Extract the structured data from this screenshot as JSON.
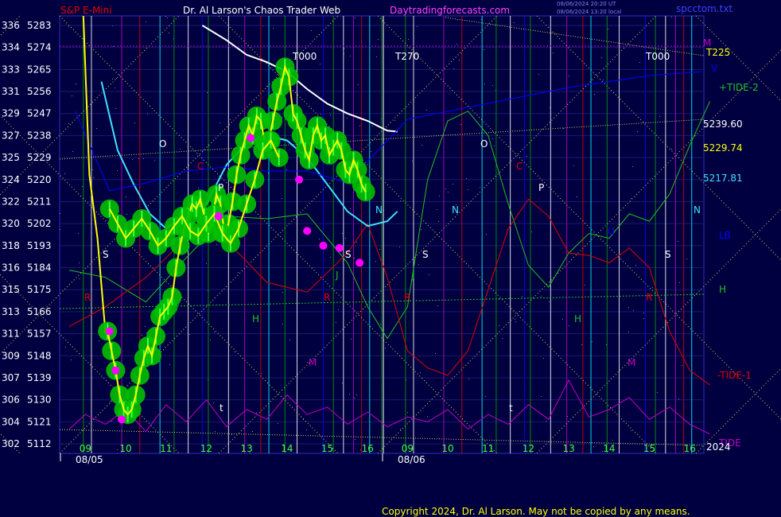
{
  "header": {
    "symbol": "S&P E-Mini",
    "title": "Dr. Al Larson's Chaos Trader Web",
    "site": "Daytradingforecasts.com",
    "time_line1": "08/06/2024 20:20 UT",
    "time_line2": "08/06/2024 13:20 local",
    "file": "spcctom.txt"
  },
  "footer": {
    "copyright": "Copyright 2024, Dr. Al Larson. May not be copied by any means."
  },
  "colors": {
    "background": "#000040",
    "price_bars": "#00c000",
    "price_line": "#ffff00",
    "cyan_avg": "#40e0ff",
    "white_avg": "#ffffff",
    "tide": "#c000c0",
    "tide1": "#e00000",
    "tide2": "#20c020",
    "blue_line": "#0000ff"
  },
  "chart_data": {
    "type": "line",
    "title": "S&P E-Mini",
    "y_axis": {
      "labels": [
        {
          "deg": "336",
          "price": "5283"
        },
        {
          "deg": "334",
          "price": "5274"
        },
        {
          "deg": "333",
          "price": "5265"
        },
        {
          "deg": "331",
          "price": "5256"
        },
        {
          "deg": "329",
          "price": "5247"
        },
        {
          "deg": "327",
          "price": "5238"
        },
        {
          "deg": "325",
          "price": "5229"
        },
        {
          "deg": "324",
          "price": "5220"
        },
        {
          "deg": "322",
          "price": "5211"
        },
        {
          "deg": "320",
          "price": "5202"
        },
        {
          "deg": "318",
          "price": "5193"
        },
        {
          "deg": "316",
          "price": "5184"
        },
        {
          "deg": "315",
          "price": "5175"
        },
        {
          "deg": "313",
          "price": "5166"
        },
        {
          "deg": "311",
          "price": "5157"
        },
        {
          "deg": "309",
          "price": "5148"
        },
        {
          "deg": "307",
          "price": "5139"
        },
        {
          "deg": "306",
          "price": "5130"
        },
        {
          "deg": "304",
          "price": "5121"
        },
        {
          "deg": "302",
          "price": "5112"
        }
      ],
      "ylim": [
        5112,
        5283
      ]
    },
    "x_axis": {
      "hour_ticks": [
        "09",
        "10",
        "11",
        "12",
        "13",
        "14",
        "15",
        "16",
        "09",
        "10",
        "11",
        "12",
        "13",
        "14",
        "15",
        "16"
      ],
      "dates": [
        "08/05",
        "08/06"
      ],
      "xlim": [
        8.5,
        16.5
      ]
    },
    "right_labels": [
      {
        "text": "M",
        "color": "#c000c0"
      },
      {
        "text": "T225",
        "color": "#ffff00"
      },
      {
        "text": "V",
        "color": "#0000ff"
      },
      {
        "text": "+TIDE-2",
        "color": "#20c020"
      },
      {
        "text": "5239.60",
        "color": "#ffffff"
      },
      {
        "text": "5229.74",
        "color": "#ffff00"
      },
      {
        "text": "5217.81",
        "color": "#40e0ff"
      },
      {
        "text": "M",
        "color": "#0000ff"
      },
      {
        "text": "N",
        "color": "#40e0ff"
      },
      {
        "text": "LB",
        "color": "#0000ff"
      },
      {
        "text": "H",
        "color": "#20c020"
      },
      {
        "text": "-TIDE-1",
        "color": "#e00000"
      },
      {
        "text": "TIDE",
        "color": "#c000c0"
      },
      {
        "text": "2024",
        "color": "#ffffff"
      }
    ],
    "markers": {
      "T000": "T000",
      "T270": "T270",
      "O": "O",
      "C": "C",
      "P": "P",
      "N": "N",
      "S": "S",
      "J": "J",
      "R": "R",
      "H": "H",
      "M": "M",
      "t": "t",
      "U": "U"
    },
    "series": [
      {
        "name": "S&P E-Mini",
        "color": "#ffff00",
        "day1_x": [
          9.55,
          9.65,
          9.75,
          9.85,
          9.95,
          10.05,
          10.15,
          10.25,
          10.35,
          10.45,
          10.55,
          10.65,
          10.75,
          10.85,
          10.95,
          11.05,
          11.15,
          11.25,
          11.35,
          11.45,
          11.55,
          11.65,
          11.75,
          11.85,
          11.95,
          12.05,
          12.15,
          12.25,
          12.35,
          12.45,
          12.55,
          12.65,
          12.75,
          12.85,
          12.95,
          13.05,
          13.15,
          13.25,
          13.35,
          13.45,
          13.55,
          13.65,
          13.75,
          13.85,
          13.95,
          14.05,
          14.15,
          14.25,
          14.35,
          14.45,
          14.55,
          14.65,
          14.75,
          14.85,
          14.95,
          15.05,
          15.15,
          15.25,
          15.35,
          15.45,
          15.55,
          15.65,
          15.75,
          15.85,
          15.95
        ],
        "day1_y": [
          5158,
          5150,
          5142,
          5132,
          5126,
          5124,
          5126,
          5132,
          5140,
          5147,
          5152,
          5148,
          5156,
          5164,
          5166,
          5168,
          5172,
          5184,
          5193,
          5200,
          5205,
          5210,
          5208,
          5212,
          5205,
          5198,
          5204,
          5214,
          5210,
          5198,
          5202,
          5211,
          5222,
          5230,
          5236,
          5242,
          5238,
          5246,
          5244,
          5235,
          5236,
          5244,
          5252,
          5258,
          5266,
          5262,
          5247,
          5244,
          5238,
          5232,
          5228,
          5238,
          5242,
          5236,
          5238,
          5230,
          5233,
          5236,
          5232,
          5224,
          5222,
          5228,
          5224,
          5218,
          5215
        ],
        "day2_x": [
          9.6,
          9.8,
          10.0,
          10.2,
          10.4,
          10.6,
          10.8,
          11.0,
          11.2,
          11.4,
          11.6,
          11.8,
          12.0,
          12.2,
          12.4,
          12.6,
          12.8,
          13.0,
          13.2,
          13.4,
          13.6,
          13.8
        ],
        "day2_y": [
          5208,
          5202,
          5196,
          5200,
          5204,
          5199,
          5193,
          5196,
          5201,
          5205,
          5199,
          5197,
          5202,
          5206,
          5198,
          5194,
          5200,
          5210,
          5220,
          5232,
          5236,
          5229
        ]
      },
      {
        "name": "+TIDE-2",
        "color": "#20c020",
        "x": [
          8.6,
          9.5,
          10.5,
          11.5,
          12.5,
          13.5,
          14.5,
          15.5,
          16.0,
          16.5,
          17.0,
          17.5,
          18.0,
          18.5,
          19.0,
          19.5,
          20.0,
          20.5,
          21.0,
          21.5,
          22.0,
          22.5,
          23.0,
          23.5,
          24.0,
          24.5
        ],
        "y": [
          5183,
          5180,
          5170,
          5188,
          5205,
          5204,
          5206,
          5186,
          5168,
          5155,
          5168,
          5220,
          5244,
          5248,
          5238,
          5210,
          5185,
          5176,
          5190,
          5198,
          5196,
          5206,
          5203,
          5214,
          5234,
          5252
        ]
      },
      {
        "name": "-TIDE-1",
        "color": "#e00000",
        "x": [
          8.6,
          9.5,
          10.5,
          11.5,
          12.5,
          13.5,
          14.5,
          15.5,
          16.0,
          16.5,
          17.0,
          17.5,
          18.0,
          18.5,
          19.0,
          19.5,
          20.0,
          20.5,
          21.0,
          21.5,
          22.0,
          22.5,
          23.0,
          23.5,
          24.0,
          24.5
        ],
        "y": [
          5160,
          5168,
          5180,
          5196,
          5195,
          5178,
          5174,
          5190,
          5202,
          5180,
          5150,
          5143,
          5140,
          5150,
          5175,
          5200,
          5212,
          5205,
          5190,
          5189,
          5186,
          5192,
          5184,
          5158,
          5142,
          5136
        ]
      },
      {
        "name": "TIDE",
        "color": "#c000c0",
        "x": [
          8.6,
          9.0,
          9.5,
          10.0,
          10.5,
          11.0,
          11.5,
          12.0,
          12.5,
          13.0,
          13.5,
          14.0,
          14.5,
          15.0,
          15.5,
          16.0,
          16.5,
          17.0,
          17.5,
          18.0,
          18.5,
          19.0,
          19.5,
          20.0,
          20.5,
          21.0,
          21.5,
          22.0,
          22.5,
          23.0,
          23.5,
          24.0,
          24.5
        ],
        "y": [
          5118,
          5124,
          5120,
          5126,
          5117,
          5128,
          5121,
          5130,
          5119,
          5126,
          5122,
          5132,
          5124,
          5127,
          5120,
          5125,
          5119,
          5123,
          5121,
          5126,
          5118,
          5124,
          5120,
          5128,
          5122,
          5138,
          5123,
          5126,
          5131,
          5122,
          5127,
          5120,
          5116
        ]
      },
      {
        "name": "Cyan average",
        "color": "#40e0ff",
        "x": [
          9.4,
          9.8,
          10.2,
          10.6,
          11.0,
          11.5,
          12.0,
          12.5,
          13.0,
          13.5,
          14.0,
          14.5,
          15.0,
          15.5,
          16.0,
          16.5,
          16.75
        ],
        "y": [
          5260,
          5232,
          5218,
          5206,
          5200,
          5206,
          5210,
          5226,
          5235,
          5238,
          5236,
          5229,
          5218,
          5207,
          5201,
          5203,
          5207
        ]
      },
      {
        "name": "White average",
        "color": "#ffffff",
        "x": [
          11.9,
          12.5,
          13.0,
          13.5,
          14.0,
          14.5,
          15.0,
          15.5,
          16.0,
          16.5,
          16.75
        ],
        "y": [
          5283,
          5277,
          5271,
          5268,
          5264,
          5257,
          5251,
          5247,
          5244,
          5240,
          5239.6
        ]
      }
    ]
  }
}
